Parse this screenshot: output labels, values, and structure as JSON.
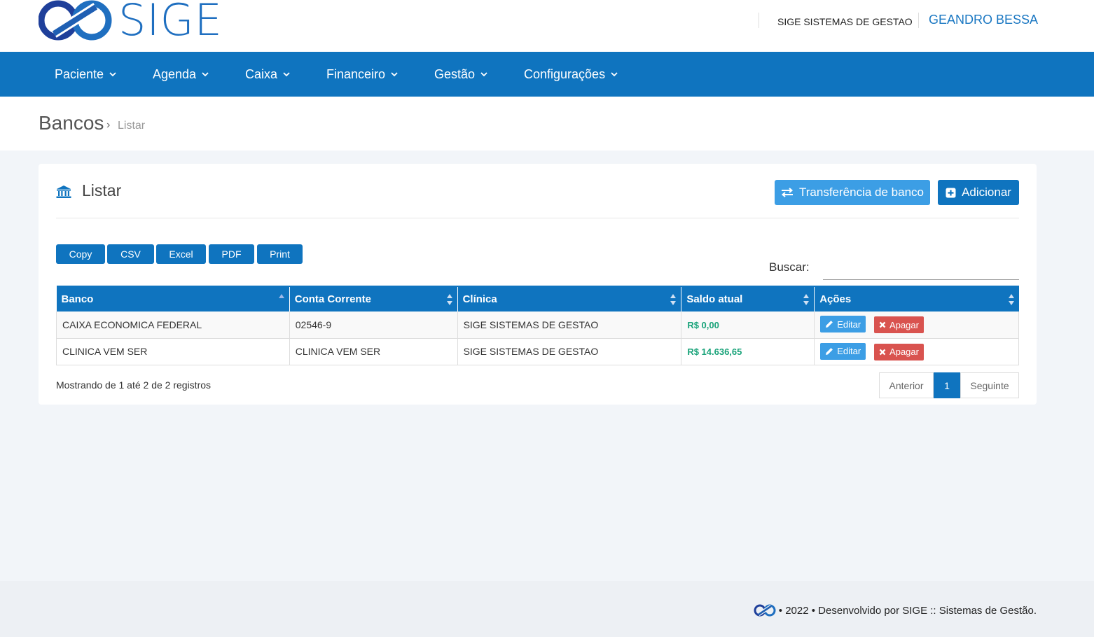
{
  "header": {
    "logo_text": "SIGE",
    "company": "SIGE SISTEMAS DE GESTAO",
    "user": "GEANDRO BESSA"
  },
  "nav": {
    "items": [
      {
        "label": "Paciente"
      },
      {
        "label": "Agenda"
      },
      {
        "label": "Caixa"
      },
      {
        "label": "Financeiro"
      },
      {
        "label": "Gestão"
      },
      {
        "label": "Configurações"
      }
    ]
  },
  "breadcrumb": {
    "title": "Bancos",
    "separator": "›",
    "sub": "Listar"
  },
  "panel": {
    "title": "Listar",
    "transfer_label": "Transferência de banco",
    "add_label": "Adicionar"
  },
  "export": {
    "buttons": [
      {
        "label": "Copy"
      },
      {
        "label": "CSV"
      },
      {
        "label": "Excel"
      },
      {
        "label": "PDF"
      },
      {
        "label": "Print"
      }
    ]
  },
  "search": {
    "label": "Buscar:",
    "value": ""
  },
  "table": {
    "columns": [
      "Banco",
      "Conta Corrente",
      "Clínica",
      "Saldo atual",
      "Ações"
    ],
    "rows": [
      {
        "banco": "CAIXA ECONOMICA FEDERAL",
        "conta": "02546-9",
        "clinica": "SIGE SISTEMAS DE GESTAO",
        "saldo": "R$ 0,00"
      },
      {
        "banco": "CLINICA VEM SER",
        "conta": "CLINICA VEM SER",
        "clinica": "SIGE SISTEMAS DE GESTAO",
        "saldo": "R$ 14.636,65"
      }
    ],
    "edit_label": "Editar",
    "delete_label": "Apagar"
  },
  "pagination": {
    "info": "Mostrando de 1 até 2 de 2 registros",
    "prev": "Anterior",
    "current": "1",
    "next": "Seguinte"
  },
  "footer": {
    "text": "• 2022 • Desenvolvido por SIGE :: Sistemas de Gestão."
  },
  "colors": {
    "primary": "#0f74bf",
    "accent": "#3c9ee5",
    "danger": "#d9534f",
    "success": "#1aa37a"
  }
}
